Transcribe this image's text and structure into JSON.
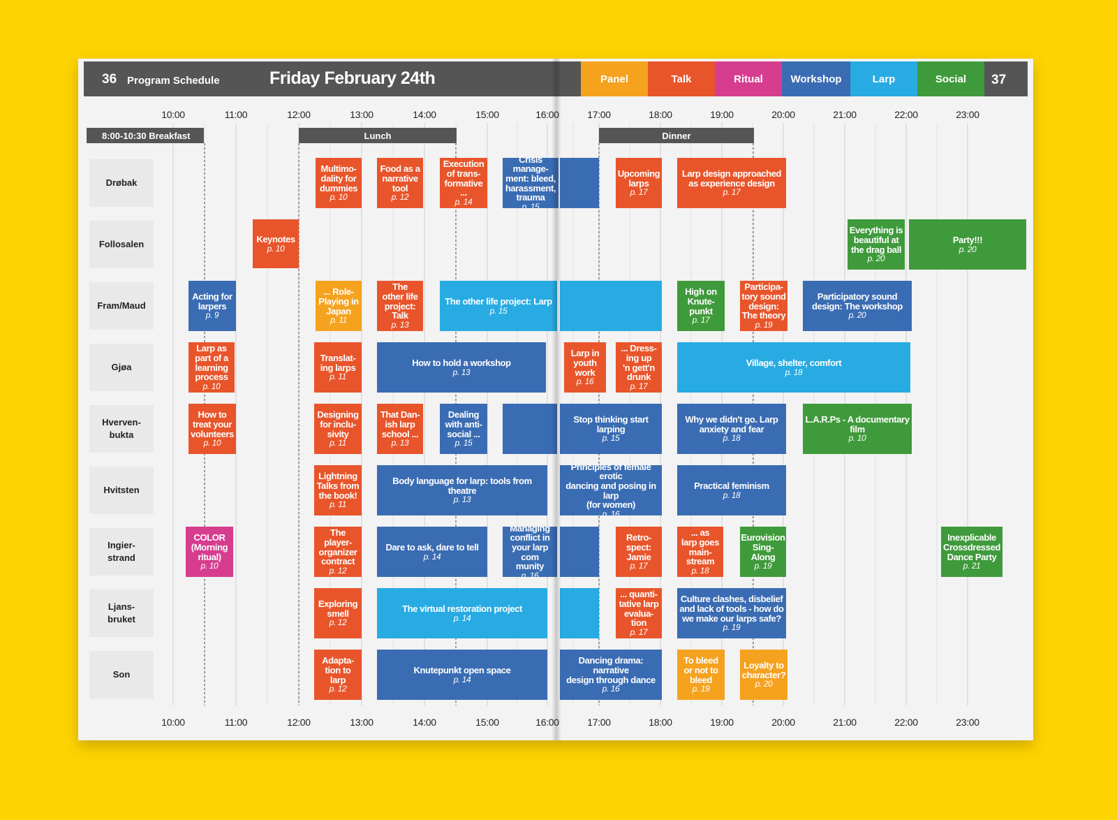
{
  "header": {
    "page_left": "36",
    "section": "Program Schedule",
    "title": "Friday February 24th",
    "page_right": "37",
    "legend": [
      {
        "label": "Panel",
        "color": "#f5a21f"
      },
      {
        "label": "Talk",
        "color": "#e8552b"
      },
      {
        "label": "Ritual",
        "color": "#d63d8f"
      },
      {
        "label": "Workshop",
        "color": "#3a6cb3"
      },
      {
        "label": "Larp",
        "color": "#27abe2"
      },
      {
        "label": "Social",
        "color": "#3f9a3b"
      }
    ]
  },
  "times": [
    "10:00",
    "11:00",
    "12:00",
    "13:00",
    "14:00",
    "15:00",
    "16:00",
    "17:00",
    "18:00",
    "19:00",
    "20:00",
    "21:00",
    "22:00",
    "23:00"
  ],
  "meals": {
    "breakfast": "8:00-10:30 Breakfast",
    "lunch": "Lunch",
    "dinner": "Dinner"
  },
  "rooms": [
    "Drøbak",
    "Follosalen",
    "Fram/Maud",
    "Gjøa",
    "Hverven-\nbukta",
    "Hvitsten",
    "Ingier-\nstrand",
    "Ljans-\nbruket",
    "Son"
  ],
  "sessions": [
    {
      "room": 0,
      "title": "Multimo-\ndality for\ndummies",
      "page": "p. 10",
      "type": "talk"
    },
    {
      "room": 0,
      "title": "Food as a\nnarrative\ntool",
      "page": "p. 12",
      "type": "talk"
    },
    {
      "room": 0,
      "title": "Execution\nof trans-\nformative\n...",
      "page": "p. 14",
      "type": "talk"
    },
    {
      "room": 0,
      "title": "Crisis manage-\nment: bleed,\nharassment,\ntrauma",
      "page": "p. 15",
      "type": "workshop"
    },
    {
      "room": 0,
      "title": "",
      "page": "",
      "type": "workshop"
    },
    {
      "room": 0,
      "title": "Upcoming\nlarps",
      "page": "p. 17",
      "type": "talk"
    },
    {
      "room": 0,
      "title": "Larp design approached\nas experience design",
      "page": "p. 17",
      "type": "talk"
    },
    {
      "room": 1,
      "title": "Keynotes",
      "page": "p. 10",
      "type": "talk"
    },
    {
      "room": 1,
      "title": "Everything is\nbeautiful at\nthe drag ball",
      "page": "p. 20",
      "type": "social"
    },
    {
      "room": 1,
      "title": "Party!!!",
      "page": "p. 20",
      "type": "social"
    },
    {
      "room": 2,
      "title": "Acting for\nlarpers",
      "page": "p. 9",
      "type": "workshop"
    },
    {
      "room": 2,
      "title": "... Role-\nPlaying in\nJapan",
      "page": "p. 11",
      "type": "panel"
    },
    {
      "room": 2,
      "title": "The\nother life\nproject:\nTalk",
      "page": "p. 13",
      "type": "talk"
    },
    {
      "room": 2,
      "title": "The other life project: Larp",
      "page": "p. 15",
      "type": "larp"
    },
    {
      "room": 2,
      "title": "",
      "page": "",
      "type": "larp"
    },
    {
      "room": 2,
      "title": "High on\nKnute-\npunkt",
      "page": "p. 17",
      "type": "social"
    },
    {
      "room": 2,
      "title": "Participa-\ntory sound\ndesign:\nThe theory",
      "page": "p. 19",
      "type": "talk"
    },
    {
      "room": 2,
      "title": "Participatory sound\ndesign: The workshop",
      "page": "p. 20",
      "type": "workshop"
    },
    {
      "room": 3,
      "title": "Larp as\npart of a\nlearning\nprocess",
      "page": "p. 10",
      "type": "talk"
    },
    {
      "room": 3,
      "title": "Translat-\ning larps",
      "page": "p. 11",
      "type": "talk"
    },
    {
      "room": 3,
      "title": "How to hold a workshop",
      "page": "p. 13",
      "type": "workshop"
    },
    {
      "room": 3,
      "title": "Larp in\nyouth\nwork",
      "page": "p. 16",
      "type": "talk"
    },
    {
      "room": 3,
      "title": "... Dress-\ning up\n'n gett'n\ndrunk",
      "page": "p. 17",
      "type": "talk"
    },
    {
      "room": 3,
      "title": "Village, shelter, comfort",
      "page": "p. 18",
      "type": "larp"
    },
    {
      "room": 4,
      "title": "How to\ntreat your\nvolunteers",
      "page": "p. 10",
      "type": "talk"
    },
    {
      "room": 4,
      "title": "Designing\nfor inclu-\nsivity",
      "page": "p. 11",
      "type": "talk"
    },
    {
      "room": 4,
      "title": "That Dan-\nish larp\nschool ...",
      "page": "p. 13",
      "type": "talk"
    },
    {
      "room": 4,
      "title": "Dealing\nwith anti-\nsocial ...",
      "page": "p. 15",
      "type": "workshop"
    },
    {
      "room": 4,
      "title": "",
      "page": "",
      "type": "workshop"
    },
    {
      "room": 4,
      "title": "Stop thinking start\nlarping",
      "page": "p. 15",
      "type": "workshop"
    },
    {
      "room": 4,
      "title": "Why we didn't go. Larp\nanxiety and fear",
      "page": "p. 18",
      "type": "workshop"
    },
    {
      "room": 4,
      "title": "L.A.R.Ps - A documentary\nfilm",
      "page": "p. 10",
      "type": "social"
    },
    {
      "room": 5,
      "title": "Lightning\nTalks from\nthe book!",
      "page": "p. 11",
      "type": "talk"
    },
    {
      "room": 5,
      "title": "Body language for larp: tools from theatre",
      "page": "p. 13",
      "type": "workshop"
    },
    {
      "room": 5,
      "title": "Principles of female erotic\ndancing and posing in larp\n(for women)",
      "page": "p. 16",
      "type": "workshop"
    },
    {
      "room": 5,
      "title": "Practical feminism",
      "page": "p. 18",
      "type": "workshop"
    },
    {
      "room": 6,
      "title": "COLOR\n(Morning\nritual)",
      "page": "p. 10",
      "type": "ritual"
    },
    {
      "room": 6,
      "title": "The\nplayer-\norganizer\ncontract",
      "page": "p. 12",
      "type": "talk"
    },
    {
      "room": 6,
      "title": "Dare to ask, dare to tell",
      "page": "p. 14",
      "type": "workshop"
    },
    {
      "room": 6,
      "title": "Managing\nconflict in\nyour larp com\nmunity",
      "page": "p. 16",
      "type": "workshop"
    },
    {
      "room": 6,
      "title": "",
      "page": "",
      "type": "workshop"
    },
    {
      "room": 6,
      "title": "Retro-\nspect:\nJamie",
      "page": "p. 17",
      "type": "talk"
    },
    {
      "room": 6,
      "title": "... as\nlarp goes\nmain-\nstream",
      "page": "p. 18",
      "type": "talk"
    },
    {
      "room": 6,
      "title": "Eurovision\nSing-\nAlong",
      "page": "p. 19",
      "type": "social"
    },
    {
      "room": 6,
      "title": "Inexplicable\nCrossdressed\nDance Party",
      "page": "p. 21",
      "type": "social"
    },
    {
      "room": 7,
      "title": "Exploring\nsmell",
      "page": "p. 12",
      "type": "talk"
    },
    {
      "room": 7,
      "title": "The virtual restoration project",
      "page": "p. 14",
      "type": "larp"
    },
    {
      "room": 7,
      "title": "",
      "page": "",
      "type": "larp"
    },
    {
      "room": 7,
      "title": "... quanti-\ntative larp\nevalua-\ntion",
      "page": "p. 17",
      "type": "talk"
    },
    {
      "room": 7,
      "title": "Culture clashes, disbelief\nand lack of tools - how do\nwe make our larps safe?",
      "page": "p. 19",
      "type": "workshop"
    },
    {
      "room": 8,
      "title": "Adapta-\ntion to\nlarp",
      "page": "p. 12",
      "type": "talk"
    },
    {
      "room": 8,
      "title": "Knutepunkt open space",
      "page": "p. 14",
      "type": "workshop"
    },
    {
      "room": 8,
      "title": "Dancing drama: narrative\ndesign through dance",
      "page": "p. 16",
      "type": "workshop"
    },
    {
      "room": 8,
      "title": "To bleed\nor not to\nbleed",
      "page": "p. 19",
      "type": "panel"
    },
    {
      "room": 8,
      "title": "Loyalty to\ncharacter?",
      "page": "p. 20",
      "type": "panel"
    }
  ]
}
